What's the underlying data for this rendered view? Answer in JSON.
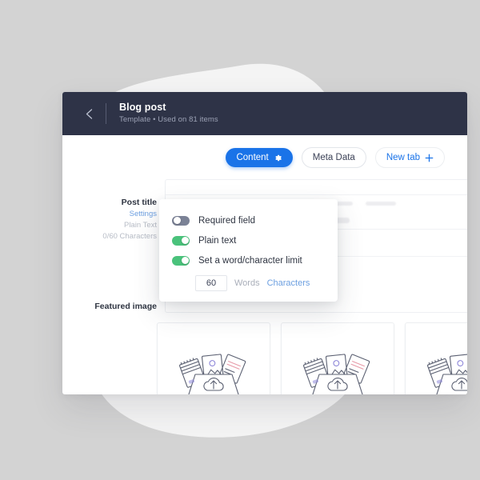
{
  "theme": {
    "page_bg": "#d3d3d3",
    "blob": "#f4f4f4",
    "titlebar_bg": "#2e3347",
    "accent_blue": "#1a73e8",
    "link_blue": "#6c9fe0",
    "toggle_on_green": "#4ac27b",
    "toggle_off_grey": "#7b8296"
  },
  "titlebar": {
    "back_icon": "chevron-left-icon",
    "title": "Blog post",
    "subtitle": "Template • Used on 81 items"
  },
  "tabs": [
    {
      "label": "Content",
      "icon": "gear-icon",
      "state": "active"
    },
    {
      "label": "Meta Data",
      "icon": "",
      "state": "inactive"
    },
    {
      "label": "New tab",
      "icon": "plus-icon",
      "state": "add"
    }
  ],
  "field_labels": {
    "post_title": "Post title",
    "settings_link": "Settings",
    "field_type": "Plain Text",
    "char_count": "0/60 Characters",
    "featured_image": "Featured image"
  },
  "popover": {
    "options": [
      {
        "label": "Required field",
        "enabled": false
      },
      {
        "label": "Plain text",
        "enabled": true
      },
      {
        "label": "Set a word/character limit",
        "enabled": true
      }
    ],
    "limit_value": "60",
    "units": [
      {
        "label": "Words",
        "selected": false
      },
      {
        "label": "Characters",
        "selected": true
      }
    ]
  },
  "upload_cards": [
    {
      "icon": "file-upload-illustration"
    },
    {
      "icon": "file-upload-illustration"
    },
    {
      "icon": "file-upload-illustration"
    }
  ],
  "skeleton": {
    "row1": [
      34,
      42,
      30,
      66,
      38
    ],
    "row2": [
      30,
      50,
      62,
      26
    ]
  }
}
